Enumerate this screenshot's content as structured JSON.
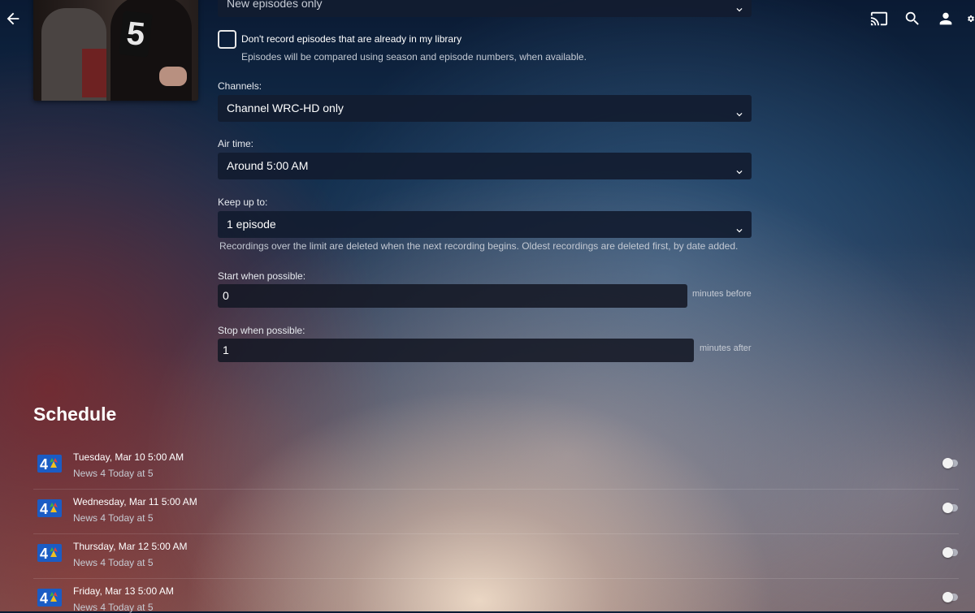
{
  "header": {
    "icons": {
      "back": "arrow-back-icon",
      "home": "home-icon",
      "menu": "menu-icon",
      "cast": "cast-icon",
      "search": "search-icon",
      "user": "user-icon",
      "settings": "settings-icon"
    }
  },
  "poster": {
    "mic_flag": "5"
  },
  "form": {
    "episodes_select": {
      "value": "New episodes only"
    },
    "library_checkbox": {
      "label": "Don't record episodes that are already in my library",
      "checked": false,
      "helper": "Episodes will be compared using season and episode numbers, when available."
    },
    "channels": {
      "label": "Channels:",
      "value": "Channel WRC-HD only"
    },
    "air_time": {
      "label": "Air time:",
      "value": "Around 5:00 AM"
    },
    "keep_up_to": {
      "label": "Keep up to:",
      "value": "1 episode",
      "helper": "Recordings over the limit are deleted when the next recording begins. Oldest recordings are deleted first, by date added."
    },
    "start_when_possible": {
      "label": "Start when possible:",
      "value": "0",
      "suffix": "minutes before"
    },
    "stop_when_possible": {
      "label": "Stop when possible:",
      "value": "1",
      "suffix": "minutes after"
    }
  },
  "schedule": {
    "title": "Schedule",
    "items": [
      {
        "date": "Tuesday, Mar 10 5:00 AM",
        "name": "News 4 Today at 5",
        "channel_logo": "nbc4-logo"
      },
      {
        "date": "Wednesday, Mar 11 5:00 AM",
        "name": "News 4 Today at 5",
        "channel_logo": "nbc4-logo"
      },
      {
        "date": "Thursday, Mar 12 5:00 AM",
        "name": "News 4 Today at 5",
        "channel_logo": "nbc4-logo"
      },
      {
        "date": "Friday, Mar 13 5:00 AM",
        "name": "News 4 Today at 5",
        "channel_logo": "nbc4-logo"
      }
    ]
  },
  "colors": {
    "field_bg": "#121c30",
    "text": "#ffffff",
    "muted_text": "#c2c8d2"
  }
}
